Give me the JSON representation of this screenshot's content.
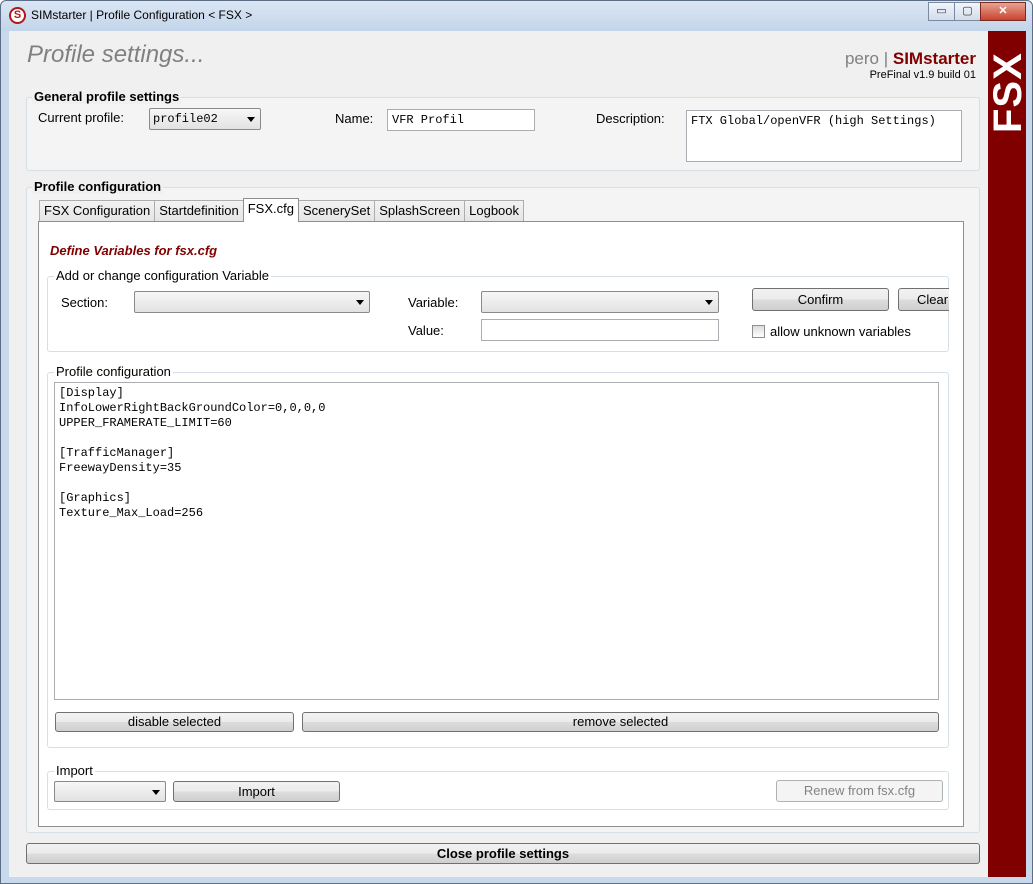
{
  "window": {
    "title": "SIMstarter | Profile Configuration < FSX >",
    "app_icon_letter": "S",
    "minimize": "▭",
    "maximize": "▢",
    "close": "✕"
  },
  "header": {
    "title": "Profile settings...",
    "user": "pero",
    "separator": "|",
    "brand": "SIMstarter",
    "version": "PreFinal v1.9 build 01"
  },
  "sidebar": {
    "label": "FSX"
  },
  "general": {
    "title": "General profile settings",
    "current_profile_label": "Current profile:",
    "current_profile_value": "profile02",
    "name_label": "Name:",
    "name_value": "VFR Profil",
    "description_label": "Description:",
    "description_value": "FTX Global/openVFR (high Settings)"
  },
  "profile_config": {
    "title": "Profile configuration",
    "tabs": [
      {
        "label": "FSX Configuration"
      },
      {
        "label": "Startdefinition"
      },
      {
        "label": "FSX.cfg"
      },
      {
        "label": "ScenerySet"
      },
      {
        "label": "SplashScreen"
      },
      {
        "label": "Logbook"
      }
    ],
    "active_tab": "FSX.cfg"
  },
  "fsxcfg": {
    "heading": "Define Variables for fsx.cfg",
    "add_group": {
      "legend": "Add or change configuration Variable",
      "section_label": "Section:",
      "section_value": "",
      "variable_label": "Variable:",
      "variable_value": "",
      "value_label": "Value:",
      "value_value": "",
      "confirm": "Confirm",
      "clear": "Clear",
      "allow_unknown": "allow unknown variables"
    },
    "profile_group": {
      "legend": "Profile configuration",
      "content": "[Display]\nInfoLowerRightBackGroundColor=0,0,0,0\nUPPER_FRAMERATE_LIMIT=60\n\n[TrafficManager]\nFreewayDensity=35\n\n[Graphics]\nTexture_Max_Load=256",
      "disable_selected": "disable selected",
      "remove_selected": "remove selected"
    },
    "import_group": {
      "legend": "Import",
      "select_value": "",
      "import": "Import",
      "renew": "Renew from fsx.cfg"
    }
  },
  "footer": {
    "close_button": "Close profile settings"
  }
}
